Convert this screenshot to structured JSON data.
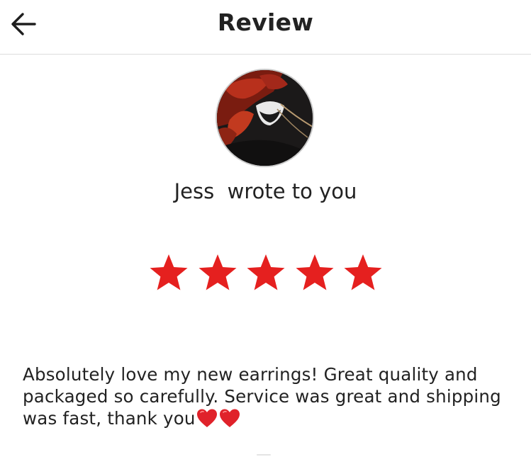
{
  "header": {
    "title": "Review",
    "back_icon": "arrow-left-icon"
  },
  "reviewer": {
    "name": "Jess",
    "action_text": "wrote to you",
    "avatar_icon": "profile-photo"
  },
  "rating": {
    "value": 5,
    "max": 5,
    "star_color": "#e5201f"
  },
  "review": {
    "text": "Absolutely love my new earrings! Great quality and packaged so carefully. Service was great and shipping was fast, thank you",
    "emoji": [
      "red-heart-icon",
      "red-heart-icon"
    ]
  },
  "colors": {
    "text": "#222222",
    "divider": "#dcdcdc",
    "accent": "#e5201f"
  }
}
